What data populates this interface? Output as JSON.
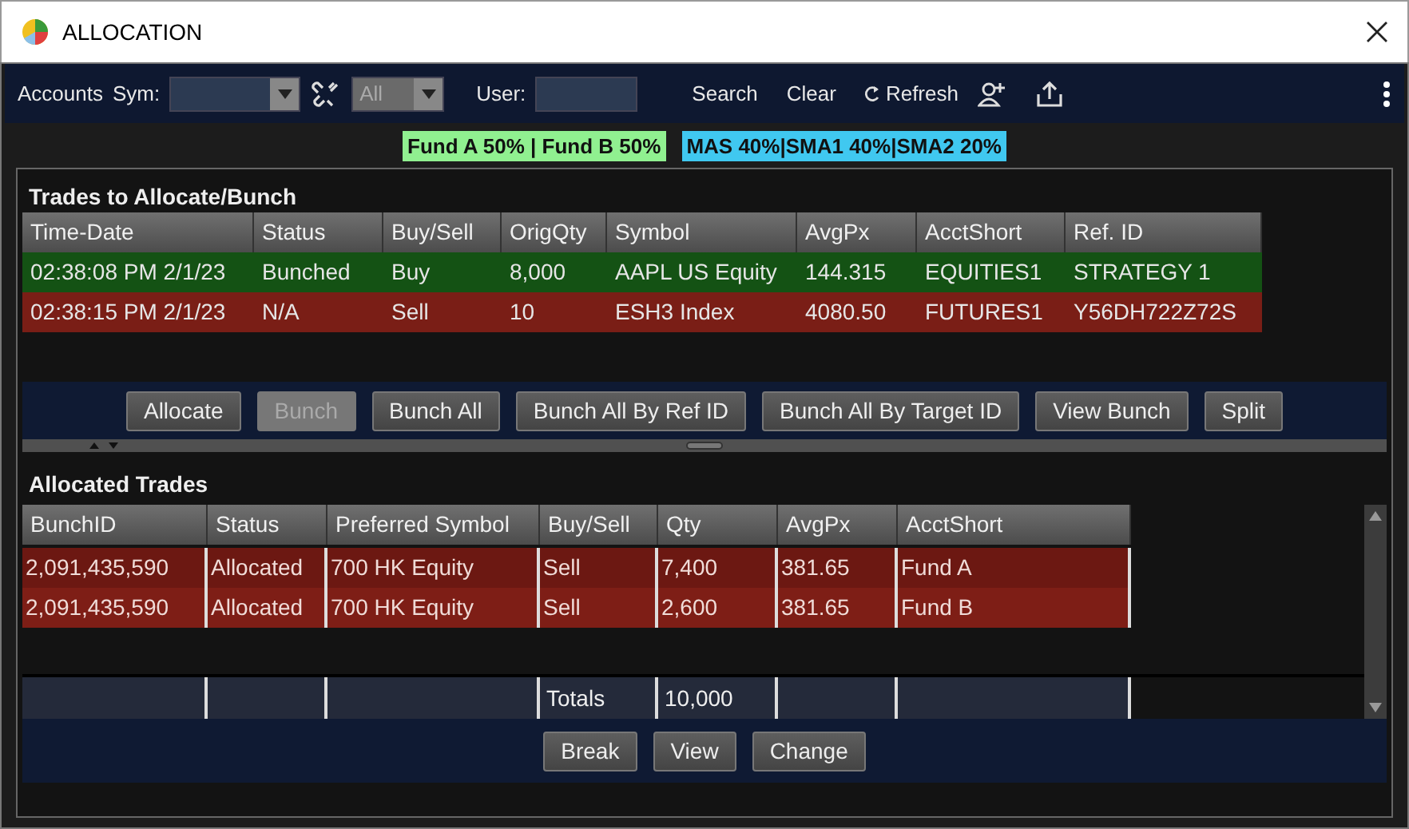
{
  "window": {
    "title": "ALLOCATION"
  },
  "toolbar": {
    "accounts_label": "Accounts",
    "sym_label": "Sym:",
    "filter_combo": {
      "value": "All",
      "disabled": true
    },
    "user_label": "User:",
    "buttons": [
      {
        "label": "Search",
        "kind": "text"
      },
      {
        "label": "Clear",
        "kind": "text"
      },
      {
        "label": "Refresh",
        "kind": "refresh"
      }
    ]
  },
  "allocation_tags": [
    {
      "label": "Fund A 50% | Fund B 50%",
      "color": "#90f090"
    },
    {
      "label": "MAS 40%|SMA1 40%|SMA2 20%",
      "color": "#40c8f0"
    }
  ],
  "trades": {
    "title": "Trades to Allocate/Bunch",
    "columns": [
      "Time-Date",
      "Status",
      "Buy/Sell",
      "OrigQty",
      "Symbol",
      "AvgPx",
      "AcctShort",
      "Ref. ID"
    ],
    "rows": [
      {
        "cells": [
          "02:38:08 PM 2/1/23",
          "Bunched",
          "Buy",
          "8,000",
          "AAPL US Equity",
          "144.315",
          "EQUITIES1",
          "STRATEGY 1"
        ],
        "color": "#145214"
      },
      {
        "cells": [
          "02:38:15 PM 2/1/23",
          "N/A",
          "Sell",
          "10",
          "ESH3 Index",
          "4080.50",
          "FUTURES1",
          "Y56DH722Z72S"
        ],
        "color": "#7a1e16"
      }
    ],
    "buttons": [
      {
        "label": "Allocate",
        "disabled": false
      },
      {
        "label": "Bunch",
        "disabled": true
      },
      {
        "label": "Bunch All",
        "disabled": false
      },
      {
        "label": "Bunch All By Ref ID",
        "disabled": false
      },
      {
        "label": "Bunch All By Target ID",
        "disabled": false
      },
      {
        "label": "View Bunch",
        "disabled": false
      },
      {
        "label": "Split",
        "disabled": false
      }
    ]
  },
  "allocated": {
    "title": "Allocated Trades",
    "columns": [
      "BunchID",
      "Status",
      "Preferred Symbol",
      "Buy/Sell",
      "Qty",
      "AvgPx",
      "AcctShort"
    ],
    "rows": [
      {
        "cells": [
          "2,091,435,590",
          "Allocated",
          "700 HK Equity",
          "Sell",
          "7,400",
          "381.65",
          "Fund A"
        ],
        "selected": true
      },
      {
        "cells": [
          "2,091,435,590",
          "Allocated",
          "700 HK Equity",
          "Sell",
          "2,600",
          "381.65",
          "Fund B"
        ],
        "selected": false
      }
    ],
    "totals": {
      "label": "Totals",
      "qty": "10,000"
    },
    "buttons": [
      {
        "label": "Break",
        "disabled": false
      },
      {
        "label": "View",
        "disabled": false
      },
      {
        "label": "Change",
        "disabled": false
      }
    ]
  }
}
